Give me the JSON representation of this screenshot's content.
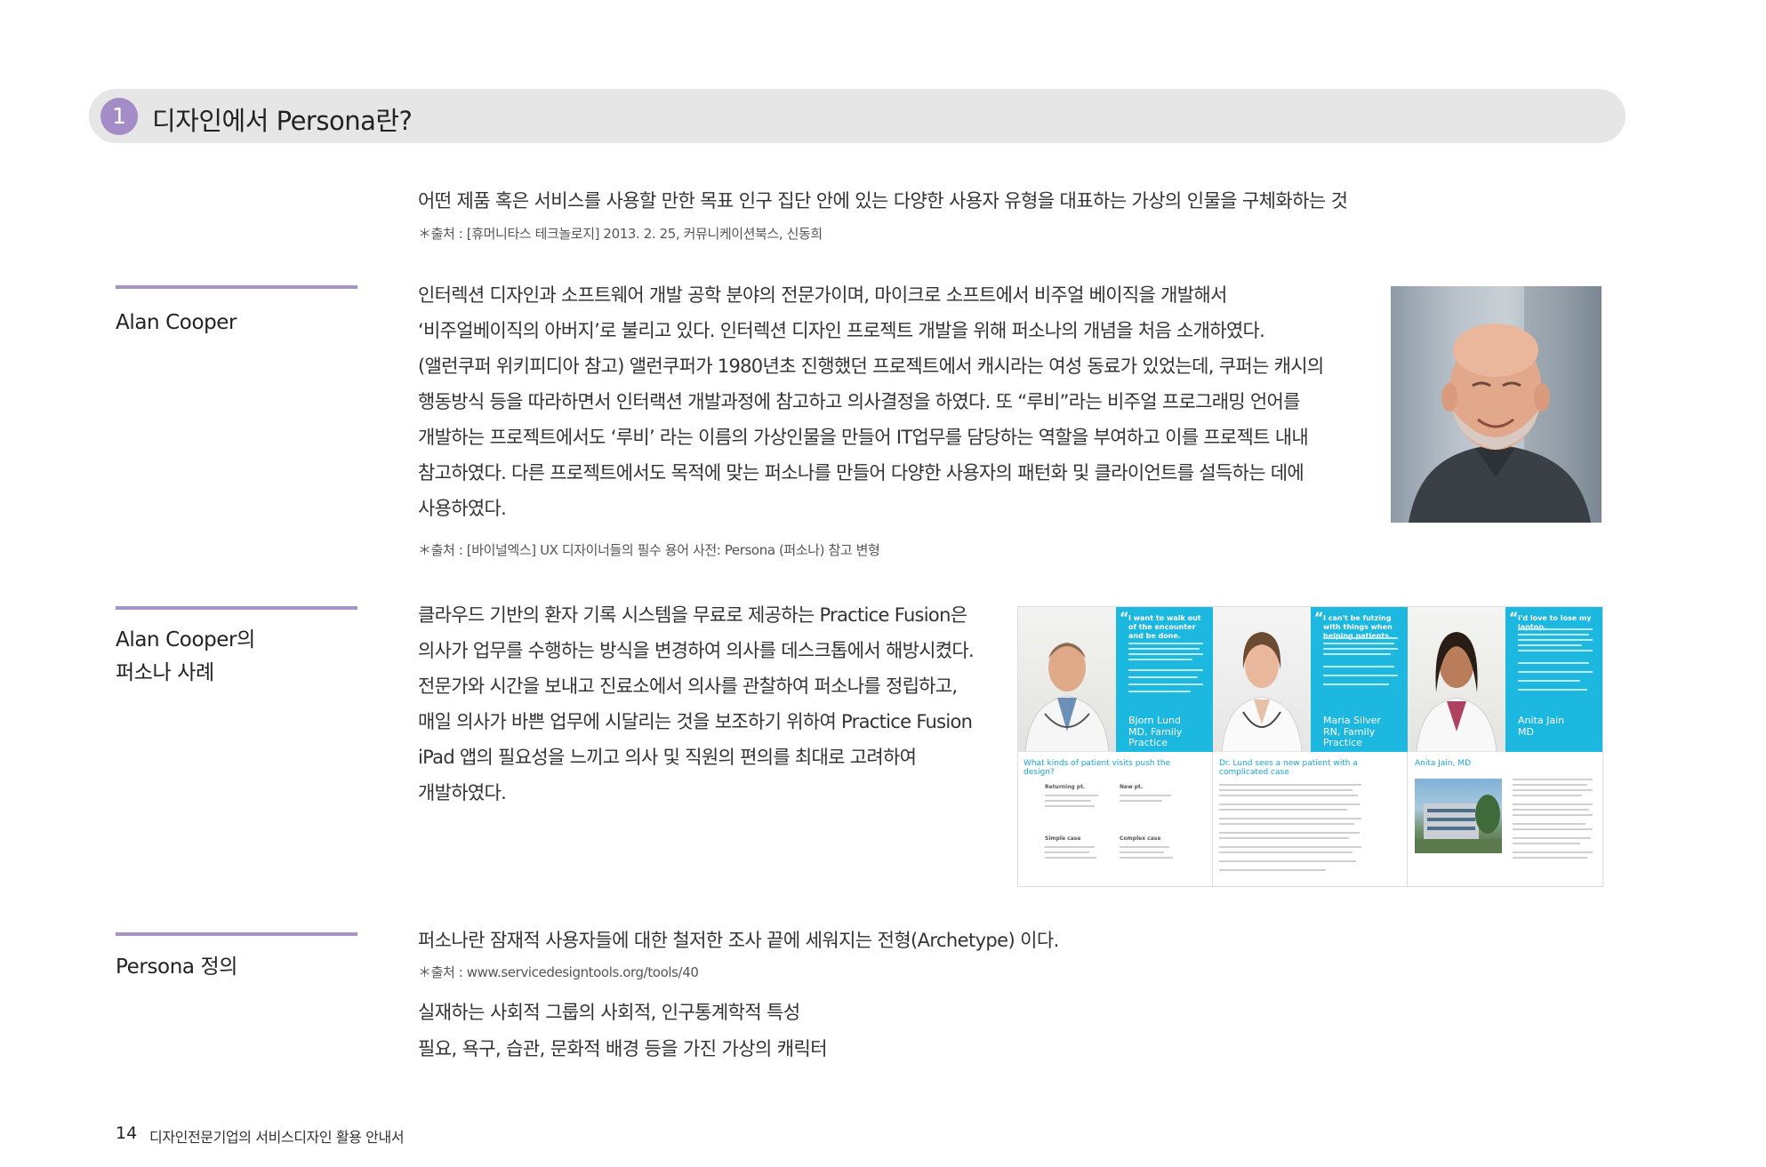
{
  "section": {
    "number": "1",
    "title": "디자인에서 Persona란?"
  },
  "intro": {
    "text": "어떤 제품 혹은 서비스를 사용할 만한 목표 인구 집단 안에 있는 다양한 사용자 유형을 대표하는 가상의 인물을 구체화하는 것",
    "source": "＊출처 : [휴머니타스 테크놀로지] 2013. 2. 25, 커뮤니케이션북스, 신동희"
  },
  "alan_cooper": {
    "label": "Alan Cooper",
    "lines": [
      "인터렉션 디자인과 소프트웨어 개발 공학 분야의 전문가이며, 마이크로 소프트에서 비주얼 베이직을 개발해서",
      "‘비주얼베이직의 아버지’로 불리고 있다. 인터렉션 디자인 프로젝트 개발을 위해 퍼소나의 개념을 처음 소개하였다.",
      "(앨런쿠퍼 위키피디아 참고) 앨런쿠퍼가 1980년초 진행했던 프로젝트에서 캐시라는 여성 동료가 있었는데, 쿠퍼는 캐시의",
      "행동방식 등을 따라하면서 인터랙션 개발과정에 참고하고 의사결정을 하였다. 또 “루비”라는 비주얼 프로그래밍 언어를",
      "개발하는 프로젝트에서도 ‘루비’ 라는 이름의 가상인물을 만들어 IT업무를 담당하는 역할을 부여하고 이를 프로젝트 내내",
      "참고하였다. 다른 프로젝트에서도 목적에 맞는 퍼소나를 만들어 다양한 사용자의 패턴화 및 클라이언트를 설득하는 데에",
      "사용하였다."
    ],
    "source": "＊출처 : [바이널엑스] UX 디자이너들의 필수 용어 사전: Persona (퍼소나)  참고 변형"
  },
  "case": {
    "label_line1": "Alan Cooper의",
    "label_line2": "퍼소나 사례",
    "lines": [
      "클라우드 기반의 환자 기록 시스템을 무료로 제공하는 Practice Fusion은",
      "의사가 업무를 수행하는 방식을 변경하여 의사를 데스크톱에서 해방시켰다.",
      "전문가와 시간을 보내고 진료소에서 의사를 관찰하여 퍼소나를 정립하고,",
      "매일 의사가 바쁜 업무에 시달리는 것을 보조하기 위하여 Practice Fusion",
      "iPad 앱의 필요성을 느끼고 의사 및 직원의 편의를 최대로 고려하여",
      "개발하였다."
    ],
    "personas": [
      {
        "quote": "I want to walk out of the encounter and be done.",
        "name": "Bjorn Lund",
        "title": "MD, Family Practice"
      },
      {
        "quote": "I can't be futzing with things when helping patients.",
        "name": "Maria Silver",
        "title": "RN, Family Practice"
      },
      {
        "quote": "I'd love to lose my laptop.",
        "name": "Anita Jain",
        "title": "MD"
      }
    ],
    "lower_headings": [
      "What kinds of patient visits push the design?",
      "Dr. Lund sees a new patient with a complicated case",
      "Anita Jain, MD"
    ],
    "visit_types": [
      "Returning pt.",
      "New pt.",
      "Simple case",
      "Complex case"
    ]
  },
  "definition": {
    "label": "Persona 정의",
    "text": "퍼소나란 잠재적 사용자들에 대한 철저한 조사 끝에 세워지는 전형(Archetype) 이다.",
    "source": "＊출처 : www.servicedesigntools.org/tools/40",
    "items": [
      "실재하는 사회적 그룹의 사회적, 인구통계학적 특성",
      "필요, 욕구, 습관, 문화적 배경 등을 가진 가상의 캐릭터"
    ]
  },
  "footer": {
    "page": "14",
    "title": "디자인전문기업의 서비스디자인 활용 안내서"
  },
  "colors": {
    "accent": "#a893c8",
    "header_bar": "#e6e6e6",
    "persona_cyan": "#1cb8df"
  }
}
